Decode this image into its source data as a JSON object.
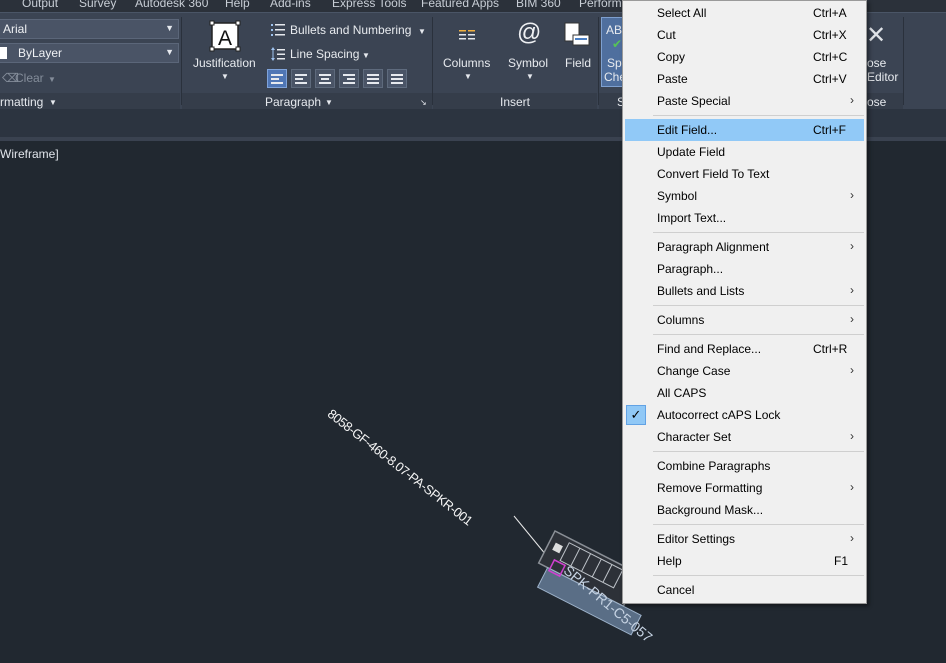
{
  "menubar": [
    "Output",
    "Survey",
    "Autodesk 360",
    "Help",
    "Add-ins",
    "Express Tools",
    "Featured Apps",
    "BIM 360",
    "Perform"
  ],
  "ribbon": {
    "font_value": "Arial",
    "layer_value": "ByLayer",
    "clear_label": "Clear",
    "formatting_label": "rmatting",
    "justification_label": "Justification",
    "bullets_label": "Bullets and Numbering",
    "line_spacing_label": "Line Spacing",
    "paragraph_label": "Paragraph",
    "columns_label": "Columns",
    "symbol_label": "Symbol",
    "field_label": "Field",
    "insert_label": "Insert",
    "spell_label_1": "Sp",
    "spell_label_2": "Che",
    "spell_panel_label": "S",
    "spell_abc": "AB",
    "close_label_1": "ose",
    "close_label_2": "Editor",
    "close_panel_label": "ose"
  },
  "viewport": {
    "label": "Wireframe]",
    "leader_text": "8058-GF-460-8.07-PA-SPKR-001",
    "tag_text": "SPK-PR1-C5-057"
  },
  "context_menu": {
    "items": [
      {
        "label": "Select All",
        "shortcut": "Ctrl+A"
      },
      {
        "label": "Cut",
        "shortcut": "Ctrl+X"
      },
      {
        "label": "Copy",
        "shortcut": "Ctrl+C"
      },
      {
        "label": "Paste",
        "shortcut": "Ctrl+V"
      },
      {
        "label": "Paste Special",
        "submenu": true
      },
      {
        "label": "Edit Field...",
        "shortcut": "Ctrl+F",
        "highlighted": true
      },
      {
        "label": "Update Field"
      },
      {
        "label": "Convert Field To Text"
      },
      {
        "label": "Symbol",
        "submenu": true
      },
      {
        "label": "Import Text..."
      },
      {
        "label": "Paragraph Alignment",
        "submenu": true
      },
      {
        "label": "Paragraph..."
      },
      {
        "label": "Bullets and Lists",
        "submenu": true
      },
      {
        "label": "Columns",
        "submenu": true
      },
      {
        "label": "Find and Replace...",
        "shortcut": "Ctrl+R"
      },
      {
        "label": "Change Case",
        "submenu": true
      },
      {
        "label": "All CAPS"
      },
      {
        "label": "Autocorrect cAPS Lock",
        "checked": true
      },
      {
        "label": "Character Set",
        "submenu": true
      },
      {
        "label": "Combine Paragraphs"
      },
      {
        "label": "Remove Formatting",
        "submenu": true
      },
      {
        "label": "Background Mask..."
      },
      {
        "label": "Editor Settings",
        "submenu": true
      },
      {
        "label": "Help",
        "shortcut": "F1"
      },
      {
        "label": "Cancel"
      }
    ],
    "submenu_glyph": "›",
    "check_glyph": "✓"
  },
  "colors": {
    "canvas": "#212830",
    "ribbon": "#3b4453",
    "menu_highlight": "#91c9f7",
    "tag_magenta": "#d040d0",
    "tag_fill": "#5a6e86"
  }
}
